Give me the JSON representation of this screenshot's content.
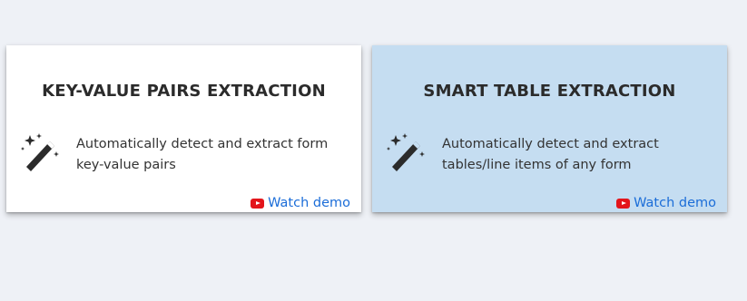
{
  "cards": [
    {
      "title": "KEY-VALUE PAIRS EXTRACTION",
      "description": "Automatically detect and extract form key-value pairs",
      "icon": "magic-wand-icon",
      "demo_icon": "youtube-icon",
      "demo_label": "Watch demo",
      "background": "#ffffff"
    },
    {
      "title": "SMART TABLE EXTRACTION",
      "description": "Automatically detect and extract tables/line items of any form",
      "icon": "magic-wand-icon",
      "demo_icon": "youtube-icon",
      "demo_label": "Watch demo",
      "background": "#c5ddf1"
    }
  ],
  "colors": {
    "page_background": "#eef1f6",
    "link": "#1b6dd8",
    "youtube_red": "#e3151b"
  }
}
